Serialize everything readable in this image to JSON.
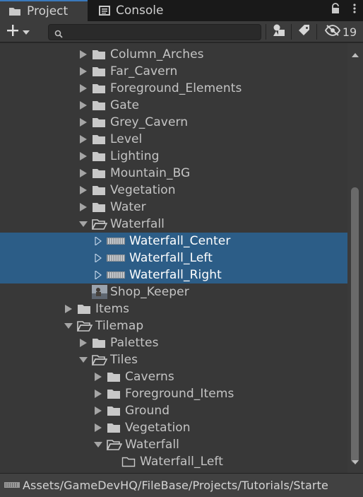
{
  "tabs": {
    "project": "Project",
    "console": "Console"
  },
  "toolbar": {
    "search_placeholder": "",
    "hidden_count": "19"
  },
  "tree": [
    {
      "label": "Column_Arches",
      "depth": 2,
      "kind": "folder",
      "expanded": false
    },
    {
      "label": "Far_Cavern",
      "depth": 2,
      "kind": "folder",
      "expanded": false
    },
    {
      "label": "Foreground_Elements",
      "depth": 2,
      "kind": "folder",
      "expanded": false
    },
    {
      "label": "Gate",
      "depth": 2,
      "kind": "folder",
      "expanded": false
    },
    {
      "label": "Grey_Cavern",
      "depth": 2,
      "kind": "folder",
      "expanded": false
    },
    {
      "label": "Level",
      "depth": 2,
      "kind": "folder",
      "expanded": false
    },
    {
      "label": "Lighting",
      "depth": 2,
      "kind": "folder",
      "expanded": false
    },
    {
      "label": "Mountain_BG",
      "depth": 2,
      "kind": "folder",
      "expanded": false
    },
    {
      "label": "Vegetation",
      "depth": 2,
      "kind": "folder",
      "expanded": false
    },
    {
      "label": "Water",
      "depth": 2,
      "kind": "folder",
      "expanded": false
    },
    {
      "label": "Waterfall",
      "depth": 2,
      "kind": "folder-open",
      "expanded": true
    },
    {
      "label": "Waterfall_Center",
      "depth": 3,
      "kind": "sprite",
      "selected": true
    },
    {
      "label": "Waterfall_Left",
      "depth": 3,
      "kind": "sprite",
      "selected": true
    },
    {
      "label": "Waterfall_Right",
      "depth": 3,
      "kind": "sprite",
      "selected": true
    },
    {
      "label": "Shop_Keeper",
      "depth": 2,
      "kind": "image"
    },
    {
      "label": "Items",
      "depth": 1,
      "kind": "folder",
      "expanded": false
    },
    {
      "label": "Tilemap",
      "depth": 1,
      "kind": "folder-open",
      "expanded": true
    },
    {
      "label": "Palettes",
      "depth": 2,
      "kind": "folder",
      "expanded": false
    },
    {
      "label": "Tiles",
      "depth": 2,
      "kind": "folder-open",
      "expanded": true
    },
    {
      "label": "Caverns",
      "depth": 3,
      "kind": "folder",
      "expanded": false
    },
    {
      "label": "Foreground_Items",
      "depth": 3,
      "kind": "folder",
      "expanded": false
    },
    {
      "label": "Ground",
      "depth": 3,
      "kind": "folder",
      "expanded": false
    },
    {
      "label": "Vegetation",
      "depth": 3,
      "kind": "folder",
      "expanded": false
    },
    {
      "label": "Waterfall",
      "depth": 3,
      "kind": "folder-open",
      "expanded": true
    },
    {
      "label": "Waterfall_Left",
      "depth": 4,
      "kind": "folder-empty"
    }
  ],
  "statusbar": {
    "path": "Assets/GameDevHQ/FileBase/Projects/Tutorials/Starte"
  },
  "colors": {
    "selection": "#2c5d87",
    "panel": "#383838",
    "accent": "#3a79bb"
  },
  "icons": {
    "project_tab": "folder-icon",
    "console_tab": "console-icon",
    "lock": "lock-icon",
    "menu": "kebab-menu-icon",
    "add": "plus-icon",
    "search": "search-icon",
    "filter_type": "shapes-icon",
    "filter_label": "tag-icon",
    "hidden": "eye-slash-icon"
  }
}
